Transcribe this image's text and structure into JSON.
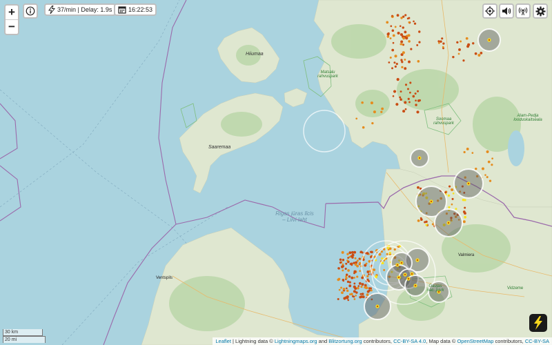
{
  "controls": {
    "zoom_in": "+",
    "zoom_out": "−",
    "rate_text": "37/min | Delay: 1.9s",
    "time_text": "16:22:53",
    "icons": [
      "info-icon",
      "lightning-icon",
      "calendar-icon",
      "locate-icon",
      "speaker-icon",
      "radio-icon",
      "gear-icon",
      "lightning-logo-icon"
    ]
  },
  "labels": {
    "hiiumaa": "Hiiumaa",
    "matsalu": "Matsalu rahvuspark",
    "saaremaa": "Saaremaa",
    "soomaa": "Soomaa rahvuspark",
    "alam_pedja": "Alam-Pedja looduskaitseala",
    "gulf": "Rīgas jūras līcis – Liivi laht",
    "ventspils": "Ventspils",
    "valmiera": "Valmiera",
    "gauja": "Gaujas nac. park",
    "viidzeme": "Vidzeme"
  },
  "scale": {
    "km": "30 km",
    "mi": "20 mi"
  },
  "attribution": {
    "leaflet": "Leaflet",
    "part1": " | Lightning data © ",
    "lm": "Lightningmaps.org",
    "and": " and ",
    "bo": "Blitzortung.org",
    "part2": " contributors, ",
    "cc1": "CC-BY-SA 4.0",
    "part3": ", Map data © ",
    "osm": "OpenStreetMap",
    "part4": " contributors, ",
    "cc2": "CC-BY-SA"
  },
  "colors": {
    "sea": "#aad3df",
    "land": "#dfe7d0",
    "forest": "#add19e",
    "border": "#8c5a9c",
    "strike_old": "#c94d14",
    "strike_mid": "#e58c1e",
    "strike_new": "#f7e21d"
  }
}
